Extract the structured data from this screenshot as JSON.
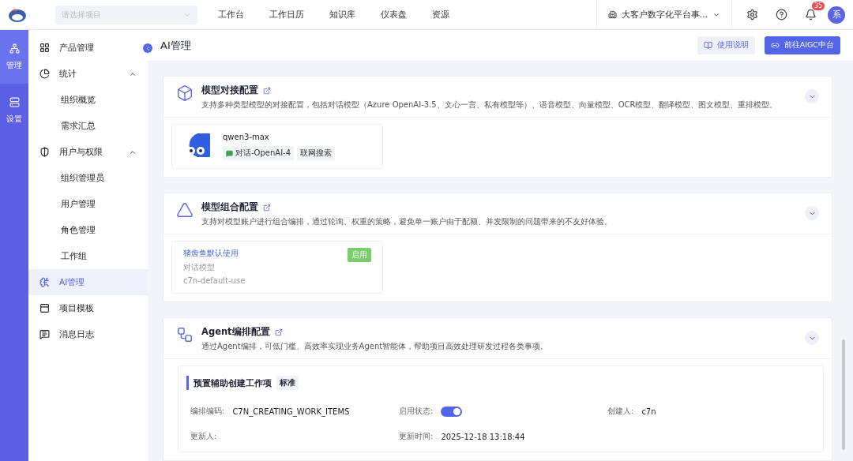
{
  "topbar": {
    "project_select": {
      "placeholder": "请选择项目"
    },
    "nav": [
      {
        "label": "工作台",
        "selected": false
      },
      {
        "label": "工作日历",
        "selected": false
      },
      {
        "label": "知识库",
        "selected": false
      },
      {
        "label": "仪表盘",
        "selected": false
      },
      {
        "label": "资源",
        "selected": false
      }
    ],
    "org": "大客户数字化平台事...",
    "notifications": "35",
    "avatar": "系"
  },
  "rail": [
    {
      "label": "管理",
      "selected": true
    },
    {
      "label": "设置",
      "selected": false
    }
  ],
  "sidebar": {
    "items": [
      {
        "label": "产品管理",
        "selected": false
      },
      {
        "label": "统计",
        "expanded": true,
        "selected": false,
        "children": [
          {
            "label": "组织概览",
            "selected": false
          },
          {
            "label": "需求汇总",
            "selected": false
          }
        ]
      },
      {
        "label": "用户与权限",
        "expanded": true,
        "selected": false,
        "children": [
          {
            "label": "组织管理员",
            "selected": false
          },
          {
            "label": "用户管理",
            "selected": false
          },
          {
            "label": "角色管理",
            "selected": false
          },
          {
            "label": "工作组",
            "selected": false
          }
        ]
      },
      {
        "label": "AI管理",
        "selected": true
      },
      {
        "label": "项目模板",
        "selected": false
      },
      {
        "label": "消息日志",
        "selected": false
      }
    ]
  },
  "page": {
    "title": "AI管理",
    "buttons": [
      {
        "label": "使用说明",
        "kind": "secondary"
      },
      {
        "label": "前往AIGC中台",
        "kind": "primary"
      }
    ]
  },
  "sections": [
    {
      "kind": "models",
      "title": "模型对接配置",
      "description": "支持多种类型模型的对接配置，包括对话模型（Azure OpenAI-3.5、文心一言、私有模型等）、语音模型、向量模型、OCR模型、翻译模型、图文模型、重排模型。",
      "expanded": false,
      "cards": [
        {
          "name": "qwen3-max",
          "tags": [
            {
              "label": "对话-OpenAI-4",
              "kind": "chat"
            },
            {
              "label": "联网搜索",
              "kind": "plain"
            }
          ]
        }
      ]
    },
    {
      "kind": "combos",
      "title": "模型组合配置",
      "description": "支持对模型账户进行组合编排，通过轮询、权重的策略，避免单一账户由于配额、并发限制的问题带来的不友好体验。",
      "expanded": false,
      "cards": [
        {
          "name": "猪齿鱼默认使用",
          "type": "对话模型",
          "code": "c7n-default-use",
          "status": "启用",
          "enabled": true
        }
      ]
    },
    {
      "kind": "agents",
      "title": "Agent编排配置",
      "description": "通过Agent编排，可低门槛、高效率实现业务Agent智能体，帮助项目高效处理研发过程各类事项。",
      "expanded": false,
      "cards": [
        {
          "name": "预置辅助创建工作项",
          "badge": "标准",
          "fields": [
            {
              "label": "编排编码:",
              "value": "C7N_CREATING_WORK_ITEMS"
            },
            {
              "label": "启用状态:",
              "toggle": true
            },
            {
              "label": "创建人:",
              "value": "c7n"
            },
            {
              "label": "更新人:"
            },
            {
              "label": "更新时间:",
              "value": "2025-12-18 13:18:44"
            }
          ]
        }
      ]
    }
  ]
}
